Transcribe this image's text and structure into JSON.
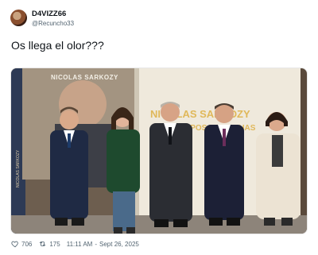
{
  "author": {
    "display_name": "D4VIZZ66",
    "handle": "@Recuncho33",
    "avatar_icon": "profile-avatar-icon"
  },
  "tweet": {
    "text": "Os llega el olor???"
  },
  "media": {
    "banner_name": "NICOLAS SARKOZY",
    "banner_title_line1": "NICOLAS SARKOZY",
    "banner_title_line2": "LOS TIEMPOS DE LUCHAS",
    "spine_text": "NICOLAS SARKOZY",
    "accent_color": "#e0b85a"
  },
  "actions": {
    "likes": "706",
    "retweets": "175",
    "time": "11:11 AM",
    "date": "Sept 26, 2025",
    "like_icon": "heart-icon",
    "retweet_icon": "retweet-icon"
  }
}
